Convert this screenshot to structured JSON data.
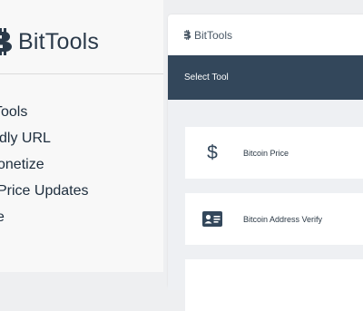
{
  "sidebar": {
    "brand": {
      "name": "BitTools",
      "icon": "bitcoin-b-icon"
    },
    "menu": [
      "Tools",
      "dly URL",
      "onetize",
      "Price Updates",
      "e"
    ]
  },
  "panel": {
    "logo": {
      "name": "BitTools",
      "icon": "bitcoin-b-icon"
    },
    "select_bar_label": "Select Tool",
    "tools": [
      {
        "label": "Bitcoin Price",
        "icon": "dollar-icon"
      },
      {
        "label": "Bitcoin Address Verify",
        "icon": "id-card-icon"
      }
    ]
  },
  "colors": {
    "navy": "#33475b",
    "sidebar_bg": "#f8f8f8",
    "tools_bg": "#eef0f3",
    "text": "#1f2f3f"
  }
}
